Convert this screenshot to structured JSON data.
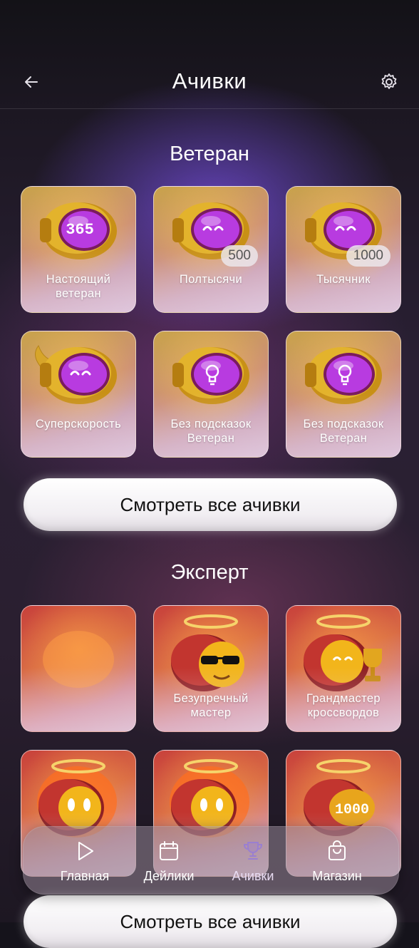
{
  "header": {
    "title": "Ачивки",
    "back_icon": "arrow-left-icon",
    "settings_icon": "gear-icon"
  },
  "sections": [
    {
      "title": "Ветеран",
      "cards": [
        {
          "label": "Настоящий ветеран",
          "art_text": "365",
          "badge": ""
        },
        {
          "label": "Полтысячи",
          "art_text": "",
          "badge": "500"
        },
        {
          "label": "Тысячник",
          "art_text": "",
          "badge": "1000"
        },
        {
          "label": "Суперскорость",
          "art_text": "",
          "badge": ""
        },
        {
          "label": "Без подсказок Ветеран",
          "art_text": "",
          "badge": ""
        },
        {
          "label": "Без подсказок Ветеран",
          "art_text": "",
          "badge": ""
        }
      ],
      "button": "Смотреть все ачивки"
    },
    {
      "title": "Эксперт",
      "cards": [
        {
          "label": "",
          "art_text": "",
          "badge": ""
        },
        {
          "label": "Безупречный мастер",
          "art_text": "",
          "badge": ""
        },
        {
          "label": "Грандмастер кроссвордов",
          "art_text": "",
          "badge": ""
        },
        {
          "label": "",
          "art_text": "",
          "badge": ""
        },
        {
          "label": "",
          "art_text": "",
          "badge": ""
        },
        {
          "label": "",
          "art_text": "1000",
          "badge": ""
        }
      ],
      "button": "Смотреть все ачивки"
    }
  ],
  "nav": [
    {
      "label": "Главная",
      "icon": "play-icon",
      "active": false
    },
    {
      "label": "Дейлики",
      "icon": "calendar-icon",
      "active": false
    },
    {
      "label": "Ачивки",
      "icon": "trophy-icon",
      "active": true
    },
    {
      "label": "Магазин",
      "icon": "shopping-bag-icon",
      "active": false
    }
  ],
  "colors": {
    "active_nav": "#9a7fd0",
    "gold": "#d9a21f",
    "purple_orb": "#b235e0",
    "red_capsule": "#b8322e"
  }
}
